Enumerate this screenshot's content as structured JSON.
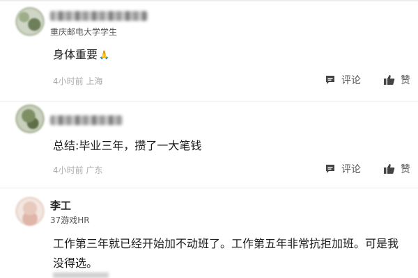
{
  "comments": [
    {
      "name_visible": "",
      "subtitle": "重庆邮电大学学生",
      "content": "身体重要",
      "content_emoji": "🙏",
      "time": "4小时前",
      "location": "上海",
      "comment_label": "评论",
      "like_label": "赞"
    },
    {
      "name_visible": "",
      "subtitle": "",
      "content": "总结:毕业三年，攒了一大笔钱",
      "time": "4小时前",
      "location": "广东",
      "comment_label": "评论",
      "like_label": "赞"
    },
    {
      "name_visible": "李工",
      "subtitle": "37游戏HR",
      "content": "工作第三年就已经开始加不动班了。工作第五年非常抗拒加班。可是我没得选。"
    }
  ],
  "icons": {
    "comment": "comment-icon",
    "like": "thumbs-up-icon"
  },
  "colors": {
    "text_primary": "#1a1a1a",
    "text_secondary": "#555555",
    "text_meta": "#aaaaaa",
    "divider": "#e8e8e8"
  }
}
